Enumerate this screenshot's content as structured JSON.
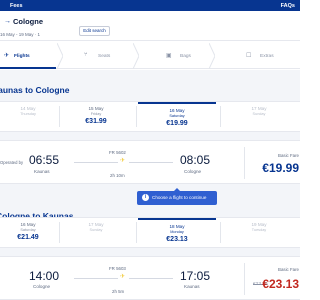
{
  "nav": {
    "fees": "Fees",
    "faqs": "FAQs"
  },
  "trip": {
    "destination": "Cologne",
    "dates_summary": "16 May - 19 May  ·  1",
    "edit_label": "Edit search"
  },
  "steps": [
    {
      "label": "Flights",
      "icon": "plane-icon",
      "active": true
    },
    {
      "label": "Seats",
      "icon": "seat-icon",
      "active": false
    },
    {
      "label": "Bags",
      "icon": "bag-icon",
      "active": false
    },
    {
      "label": "Extras",
      "icon": "extras-icon",
      "active": false
    }
  ],
  "outbound": {
    "title": "Kaunas to Cologne",
    "dates": [
      {
        "date": "14 May",
        "weekday": "Thursday",
        "price": ""
      },
      {
        "date": "15 May",
        "weekday": "Friday",
        "price": "€31.99"
      },
      {
        "date": "16 May",
        "weekday": "Saturday",
        "price": "€19.99"
      },
      {
        "date": "17 May",
        "weekday": "Sunday",
        "price": ""
      }
    ],
    "flight": {
      "operated_by": "Operated by",
      "dep_time": "06:55",
      "dep_city": "Kaunas",
      "number": "FR 5602",
      "duration": "2h 10m",
      "arr_time": "08:05",
      "arr_city": "Cologne",
      "fare_label": "Basic Fare",
      "price": "€19.99"
    }
  },
  "inbound": {
    "title": "Cologne to Kaunas",
    "dates": [
      {
        "date": "16 May",
        "weekday": "Saturday",
        "price": "€21.49"
      },
      {
        "date": "17 May",
        "weekday": "Sunday",
        "price": ""
      },
      {
        "date": "18 May",
        "weekday": "Monday",
        "price": "€23.13"
      },
      {
        "date": "19 May",
        "weekday": "Tuesday",
        "price": ""
      }
    ],
    "flight": {
      "dep_time": "14:00",
      "dep_city": "Cologne",
      "number": "FR 5603",
      "duration": "2h 5m",
      "arr_time": "17:05",
      "arr_city": "Kaunas",
      "fare_label": "Basic Fare",
      "old_price": "€23.55",
      "price": "€23.13"
    }
  },
  "toast": {
    "text": "Choose a flight to continue",
    "icon": "info-icon"
  },
  "colors": {
    "brand": "#073590",
    "accent": "#f1c933",
    "sale": "#c2281f",
    "toast": "#2f5fd1"
  }
}
